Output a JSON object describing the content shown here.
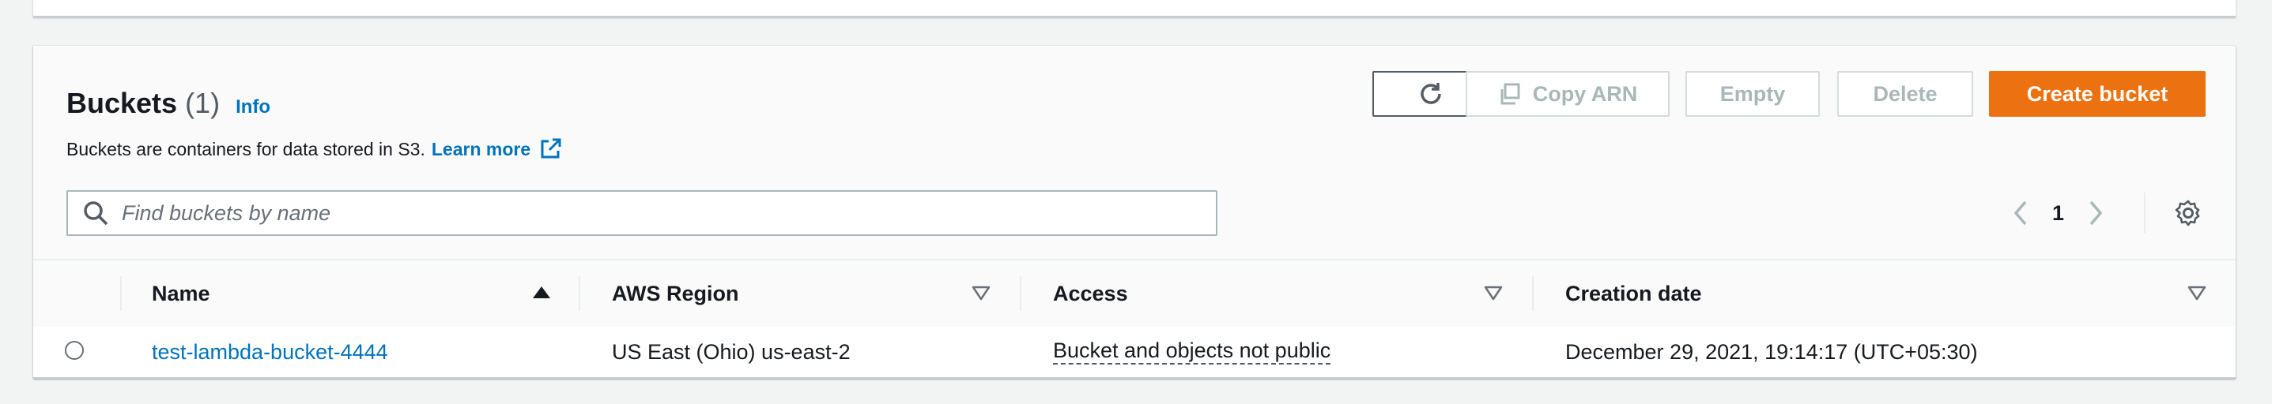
{
  "header": {
    "title": "Buckets",
    "count": "(1)",
    "info_link": "Info",
    "description": "Buckets are containers for data stored in S3.",
    "learn_more": "Learn more"
  },
  "toolbar": {
    "copy_arn_label": "Copy ARN",
    "empty_label": "Empty",
    "delete_label": "Delete",
    "create_bucket_label": "Create bucket"
  },
  "search": {
    "placeholder": "Find buckets by name",
    "value": ""
  },
  "pagination": {
    "current_page": "1"
  },
  "table": {
    "columns": [
      {
        "label": "Name",
        "sort": "ascending"
      },
      {
        "label": "AWS Region",
        "sort": "none"
      },
      {
        "label": "Access",
        "sort": "none"
      },
      {
        "label": "Creation date",
        "sort": "none"
      }
    ],
    "rows": [
      {
        "name": "test-lambda-bucket-4444",
        "region": "US East (Ohio) us-east-2",
        "access": "Bucket and objects not public",
        "creation_date": "December 29, 2021, 19:14:17 (UTC+05:30)"
      }
    ]
  },
  "colors": {
    "primary": "#ec7211",
    "link": "#0073bb",
    "disabled_text": "#aab7b8"
  },
  "icons": [
    "refresh-icon",
    "copy-icon",
    "external-link-icon",
    "search-icon",
    "chevron-left-icon",
    "chevron-right-icon",
    "settings-icon",
    "sort-ascending-icon",
    "sort-descending-outline-icon"
  ]
}
